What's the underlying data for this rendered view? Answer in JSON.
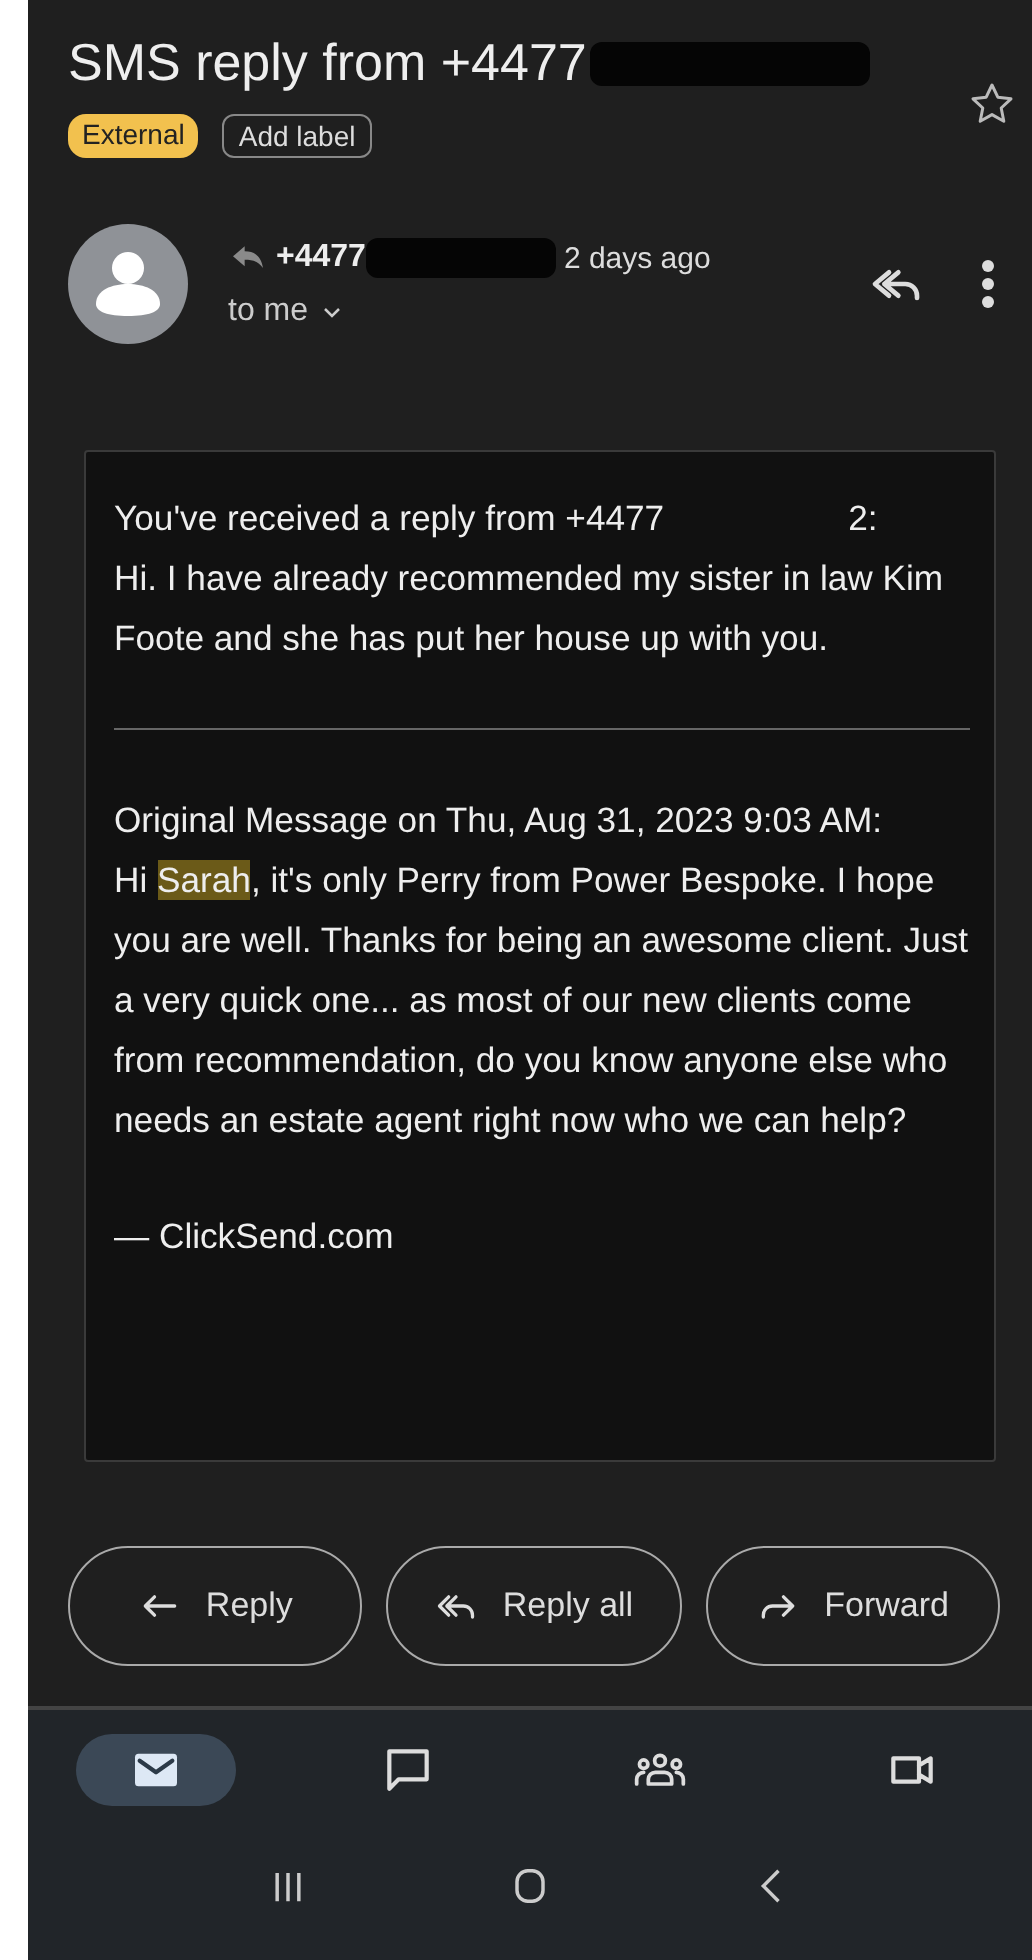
{
  "subject": {
    "title": "SMS reply from +4477",
    "starred": false
  },
  "labels": [
    {
      "text": "External",
      "kind": "tag"
    },
    {
      "text": "Add label",
      "kind": "action"
    }
  ],
  "sender": {
    "name": "+4477",
    "time": "2 days ago",
    "recipient": "to me"
  },
  "message": {
    "intro_start": "You've received a reply from +4477",
    "intro_end": "2:",
    "reply": "Hi. I have already recommended my sister in law Kim Foote and she has put her house up with you.",
    "original_heading": "Original Message on Thu, Aug 31, 2023 9:03 AM:",
    "original": [
      {
        "text": "Hi ",
        "highlighted": false
      },
      {
        "text": "Sarah",
        "highlighted": true
      },
      {
        "text": ", it's only Perry from Power Bespoke. I hope you are well. Thanks for being an awesome client. Just a very quick one... as most of our new clients come from recommendation, do you know anyone else who needs an estate agent right now who we can help?",
        "highlighted": false
      }
    ],
    "signature": "— ClickSend.com"
  },
  "actions": [
    {
      "label": "Reply",
      "kind": "reply"
    },
    {
      "label": "Reply all",
      "kind": "reply_all"
    },
    {
      "label": "Forward",
      "kind": "forward"
    }
  ],
  "nav": [
    {
      "kind": "mail",
      "selected": true
    },
    {
      "kind": "chat",
      "selected": false
    },
    {
      "kind": "spaces",
      "selected": false
    },
    {
      "kind": "meet",
      "selected": false
    }
  ]
}
